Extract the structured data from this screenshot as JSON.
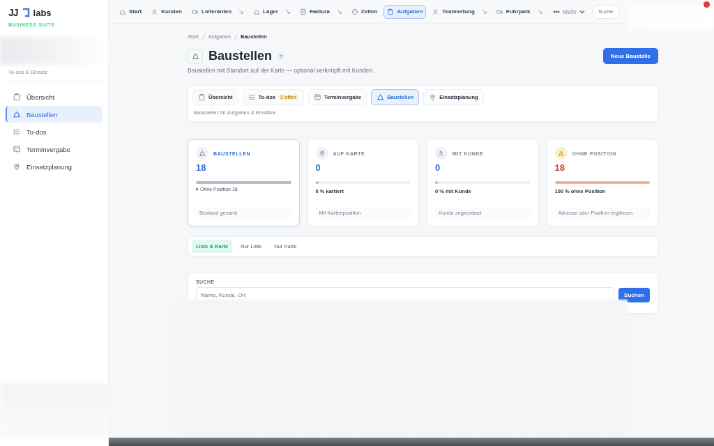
{
  "brand": {
    "logo": "JJ",
    "name": "labs",
    "tagline": "BUSINESS SUITE"
  },
  "sidebar": {
    "subtitle": "To-dos & Einsatz",
    "items": [
      {
        "label": "Übersicht",
        "selected": false
      },
      {
        "label": "Baustellen",
        "selected": true
      },
      {
        "label": "To-dos",
        "selected": false
      },
      {
        "label": "Terminvergabe",
        "selected": false
      },
      {
        "label": "Einsatzplanung",
        "selected": false
      }
    ]
  },
  "topnav": {
    "items": [
      {
        "label": "Start",
        "selected": false,
        "has_menu": false
      },
      {
        "label": "Kunden",
        "selected": false,
        "has_menu": false
      },
      {
        "label": "Lieferanten",
        "selected": false,
        "has_menu": true
      },
      {
        "label": "Lager",
        "selected": false,
        "has_menu": true
      },
      {
        "label": "Faktura",
        "selected": false,
        "has_menu": true
      },
      {
        "label": "Zeiten",
        "selected": false,
        "has_menu": false
      },
      {
        "label": "Aufgaben",
        "selected": true,
        "has_menu": false
      },
      {
        "label": "Teamleitung",
        "selected": false,
        "has_menu": true
      },
      {
        "label": "Fuhrpark",
        "selected": false,
        "has_menu": true
      }
    ],
    "more": "Mehr",
    "search_placeholder": "Suche"
  },
  "breadcrumb": [
    {
      "label": "Start",
      "current": false
    },
    {
      "label": "Aufgaben",
      "current": false
    },
    {
      "label": "Baustellen",
      "current": true
    }
  ],
  "page": {
    "title": "Baustellen",
    "help": "?",
    "description": "Baustellen mit Standort auf der Karte — optional verknüpft mit Kunden.",
    "primary_button": "Neue Baustelle"
  },
  "subtabs": {
    "items": [
      {
        "label": "Übersicht",
        "selected": false
      },
      {
        "label": "To-dos",
        "selected": false,
        "badge": "2 offen"
      },
      {
        "label": "Terminvergabe",
        "selected": false
      },
      {
        "label": "Baustellen",
        "selected": true
      },
      {
        "label": "Einsatzplanung",
        "selected": false
      }
    ],
    "caption": "Baustellen für Aufgaben & Einsätze"
  },
  "stats": [
    {
      "label": "BAUSTELLEN",
      "value": "18",
      "color": "#2f6fdb",
      "level": 1,
      "selected": true,
      "note": "Ohne Position 18",
      "footer": "Bestand gesamt"
    },
    {
      "label": "AUF KARTE",
      "value": "0",
      "color": "#2f6fdb",
      "level": 0,
      "selected": false,
      "caption": "0 % kartiert",
      "footer": "Mit Kartenposition"
    },
    {
      "label": "MIT KUNDE",
      "value": "0",
      "color": "#2f6fdb",
      "level": 0,
      "selected": false,
      "caption": "0 % mit Kunde",
      "footer": "Kunde zugeordnet"
    },
    {
      "label": "OHNE POSITION",
      "value": "18",
      "color": "#d9412f",
      "level": 1,
      "selected": false,
      "caption": "100 % ohne Position",
      "footer": "Adresse oder Position ergänzen"
    }
  ],
  "view_modes": [
    {
      "label": "Liste & Karte",
      "selected": true
    },
    {
      "label": "Nur Liste",
      "selected": false
    },
    {
      "label": "Nur Karte",
      "selected": false
    }
  ],
  "search": {
    "label": "SUCHE",
    "placeholder": "Name, Kunde, Ort",
    "button": "Suchen"
  }
}
